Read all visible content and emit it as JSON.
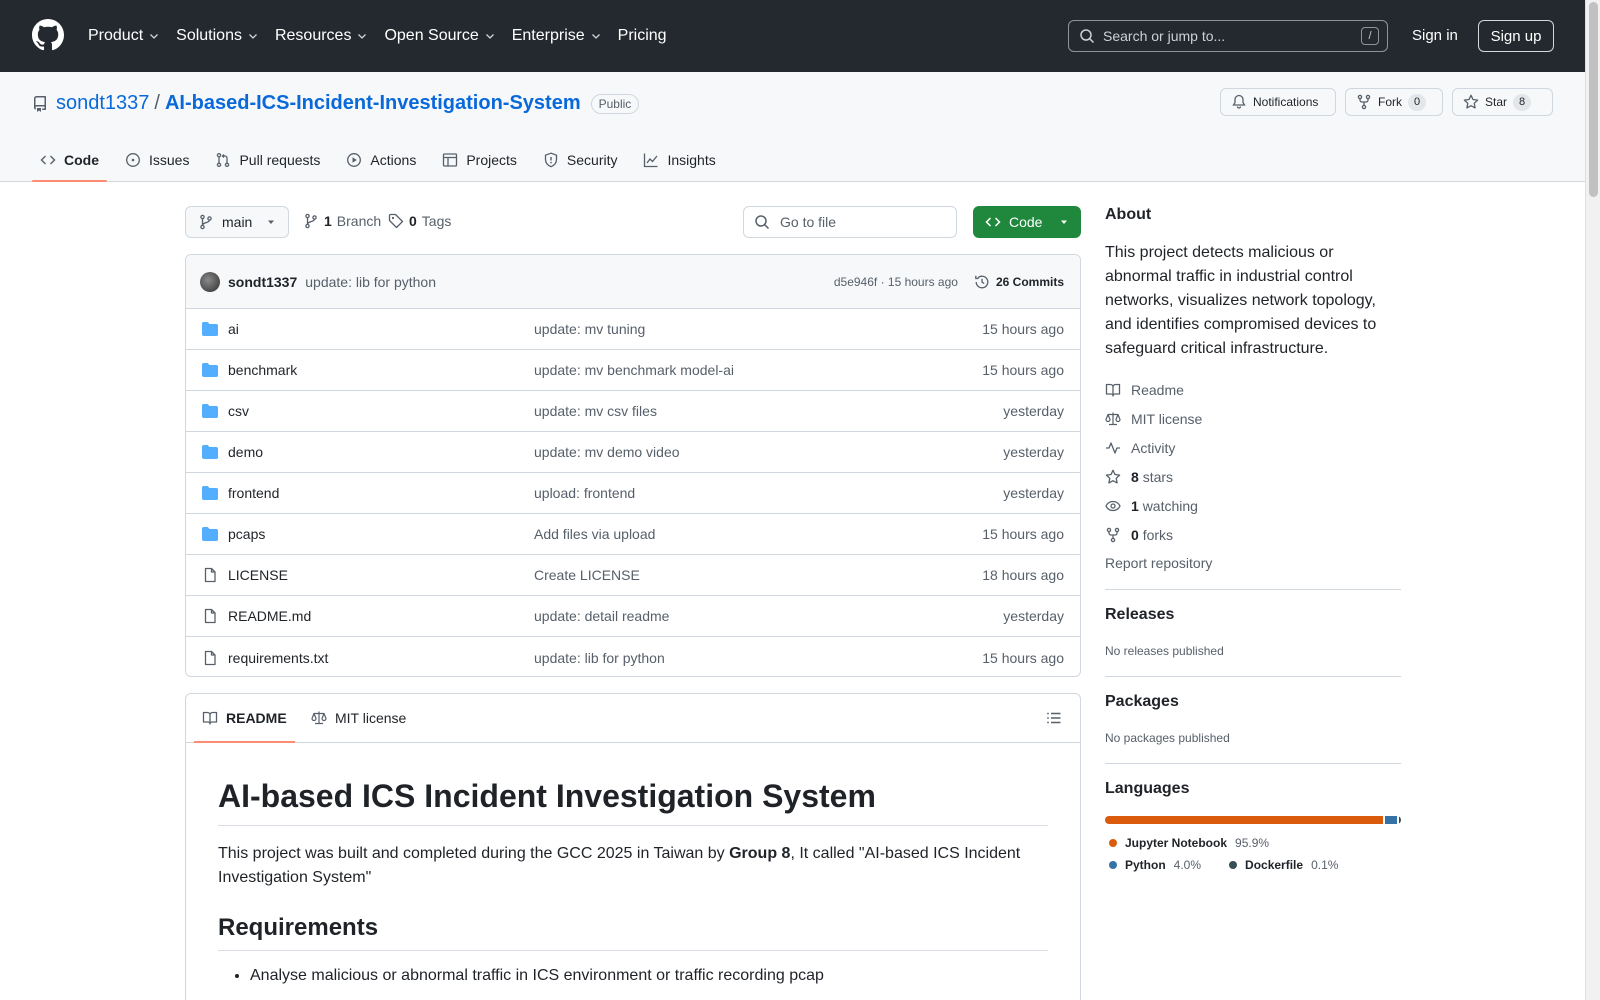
{
  "header": {
    "nav": [
      "Product",
      "Solutions",
      "Resources",
      "Open Source",
      "Enterprise",
      "Pricing"
    ],
    "search_placeholder": "Search or jump to...",
    "search_key": "/",
    "sign_in": "Sign in",
    "sign_up": "Sign up"
  },
  "repo": {
    "owner": "sondt1337",
    "separator": "/",
    "name": "AI-based-ICS-Incident-Investigation-System",
    "visibility": "Public",
    "notifications_label": "Notifications",
    "fork_label": "Fork",
    "fork_count": "0",
    "star_label": "Star",
    "star_count": "8"
  },
  "tabs": [
    "Code",
    "Issues",
    "Pull requests",
    "Actions",
    "Projects",
    "Security",
    "Insights"
  ],
  "toolbar": {
    "branch": "main",
    "branch_count": "1",
    "branch_label": "Branch",
    "tag_count": "0",
    "tag_label": "Tags",
    "goto_file": "Go to file",
    "code_button": "Code"
  },
  "commit": {
    "author": "sondt1337",
    "message": "update: lib for python",
    "meta": "d5e946f · 15 hours ago",
    "commits": "26 Commits"
  },
  "files": [
    {
      "name": "ai",
      "type": "folder",
      "message": "update: mv tuning",
      "date": "15 hours ago"
    },
    {
      "name": "benchmark",
      "type": "folder",
      "message": "update: mv benchmark model-ai",
      "date": "15 hours ago"
    },
    {
      "name": "csv",
      "type": "folder",
      "message": "update: mv csv files",
      "date": "yesterday"
    },
    {
      "name": "demo",
      "type": "folder",
      "message": "update: mv demo video",
      "date": "yesterday"
    },
    {
      "name": "frontend",
      "type": "folder",
      "message": "upload: frontend",
      "date": "yesterday"
    },
    {
      "name": "pcaps",
      "type": "folder",
      "message": "Add files via upload",
      "date": "15 hours ago"
    },
    {
      "name": "LICENSE",
      "type": "file",
      "message": "Create LICENSE",
      "date": "18 hours ago"
    },
    {
      "name": "README.md",
      "type": "file",
      "message": "update: detail readme",
      "date": "yesterday"
    },
    {
      "name": "requirements.txt",
      "type": "file",
      "message": "update: lib for python",
      "date": "15 hours ago"
    }
  ],
  "readme": {
    "tab_readme": "README",
    "tab_license": "MIT license",
    "h1": "AI-based ICS Incident Investigation System",
    "p_before": "This project was built and completed during the GCC 2025 in Taiwan by ",
    "p_bold": "Group 8",
    "p_after": ", It called \"AI-based ICS Incident Investigation System\"",
    "h2": "Requirements",
    "bullet1": "Analyse malicious or abnormal traffic in ICS environment or traffic recording pcap"
  },
  "about": {
    "title": "About",
    "description": "This project detects malicious or abnormal traffic in industrial control networks, visualizes network topology, and identifies compromised devices to safeguard critical infrastructure.",
    "readme": "Readme",
    "license": "MIT license",
    "activity": "Activity",
    "stars_count": "8",
    "stars_label": "stars",
    "watching_count": "1",
    "watching_label": "watching",
    "forks_count": "0",
    "forks_label": "forks",
    "report": "Report repository"
  },
  "releases": {
    "title": "Releases",
    "text": "No releases published"
  },
  "packages": {
    "title": "Packages",
    "text": "No packages published"
  },
  "languages": {
    "title": "Languages",
    "items": [
      {
        "name": "Jupyter Notebook",
        "percent": "95.9%",
        "color": "#DA5B0B",
        "value": 95.9
      },
      {
        "name": "Python",
        "percent": "4.0%",
        "color": "#3572A5",
        "value": 4.0
      },
      {
        "name": "Dockerfile",
        "percent": "0.1%",
        "color": "#384d54",
        "value": 0.1
      }
    ]
  }
}
